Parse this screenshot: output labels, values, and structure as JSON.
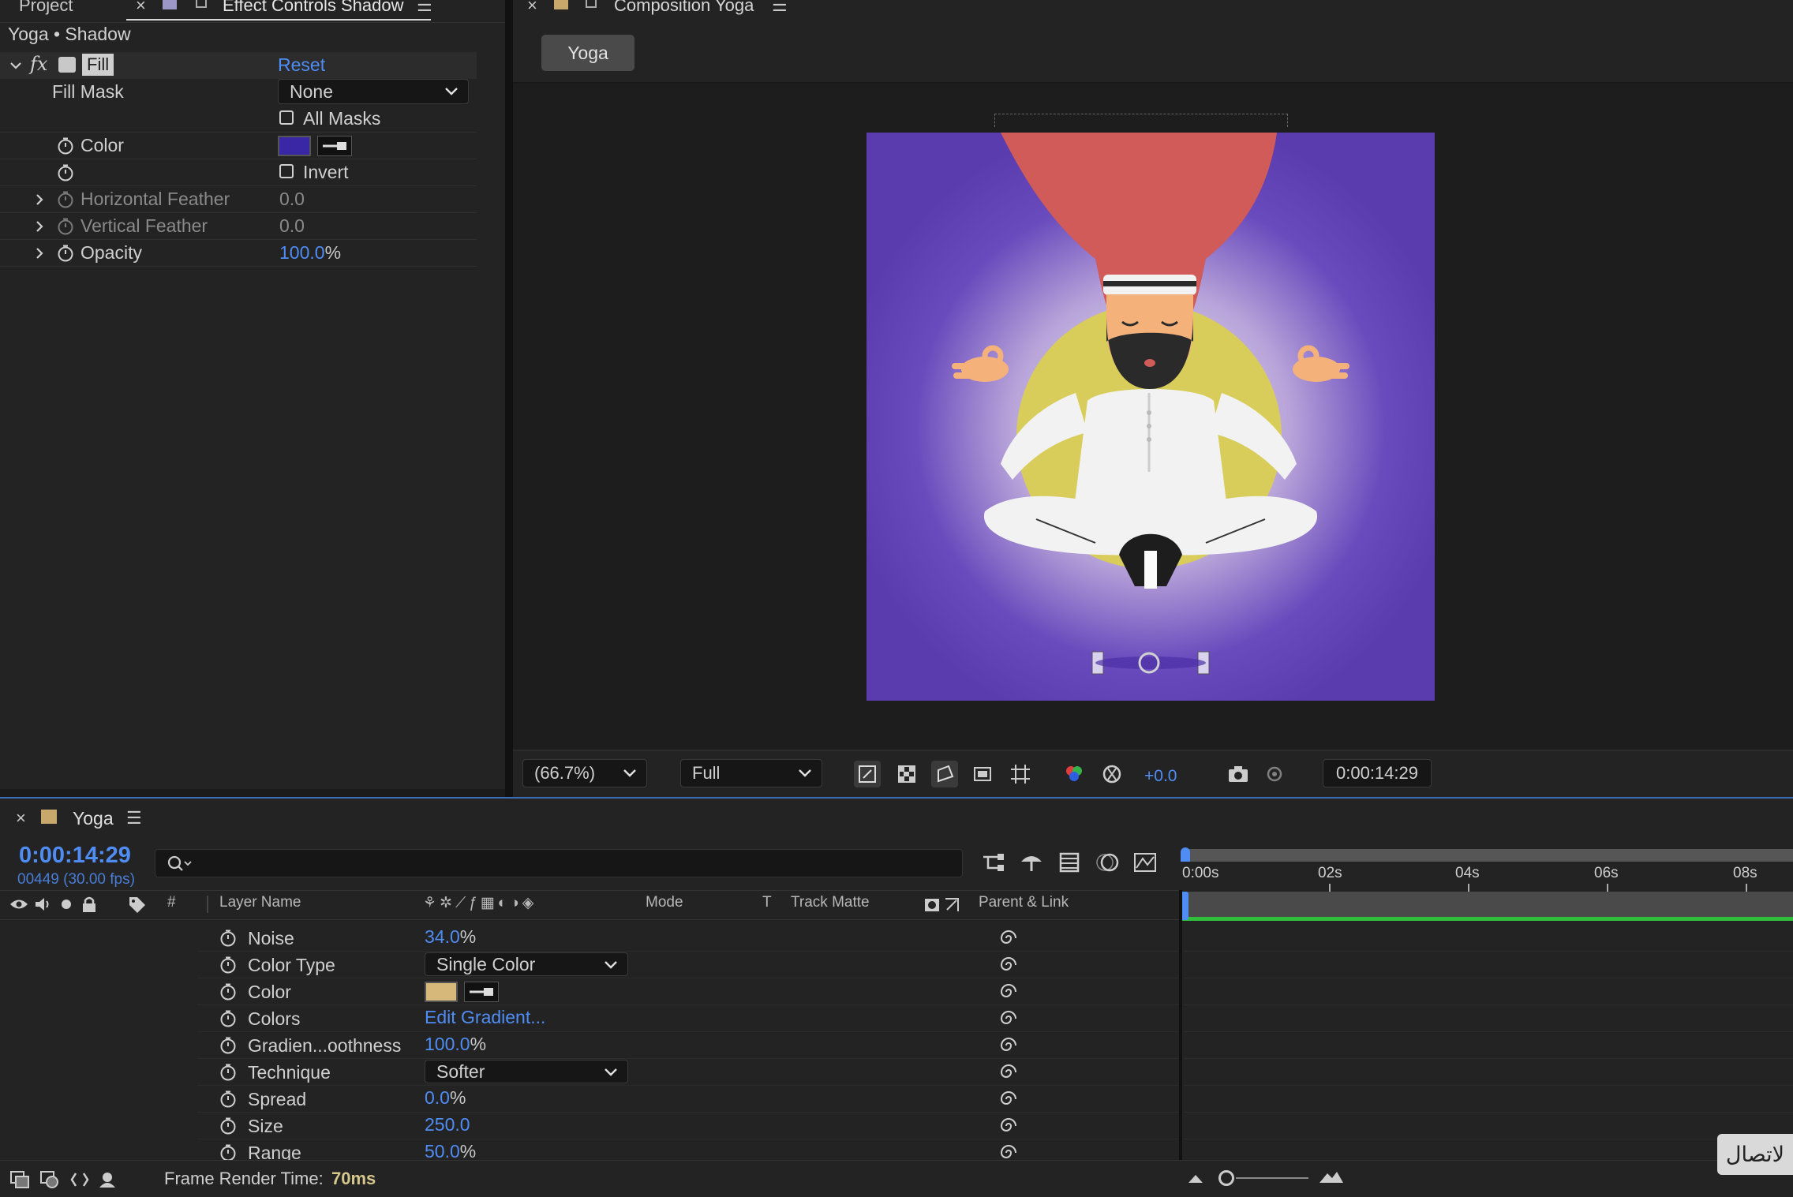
{
  "effect_controls": {
    "tab_project": "Project",
    "tab_title": "Effect Controls Shadow",
    "breadcrumb": "Yoga • Shadow",
    "effect": {
      "fx_label": "fx",
      "name": "Fill",
      "reset_label": "Reset"
    },
    "fill_mask": {
      "label": "Fill Mask",
      "value": "None"
    },
    "all_masks": {
      "label": "All Masks"
    },
    "color": {
      "label": "Color",
      "swatch": "#3a27a6"
    },
    "invert": {
      "label": "Invert"
    },
    "horizontal_feather": {
      "label": "Horizontal Feather",
      "value": "0.0"
    },
    "vertical_feather": {
      "label": "Vertical Feather",
      "value": "0.0"
    },
    "opacity": {
      "label": "Opacity",
      "value": "100.0",
      "unit": "%"
    }
  },
  "composition": {
    "tab_title": "Composition Yoga",
    "tab_button": "Yoga",
    "zoom": "(66.7%)",
    "resolution": "Full",
    "exposure": "+0.0",
    "timecode": "0:00:14:29"
  },
  "timeline": {
    "tab_title": "Yoga",
    "timecode": "0:00:14:29",
    "frame_info": "00449 (30.00 fps)",
    "columns": {
      "number": "#",
      "layer_name": "Layer Name",
      "mode": "Mode",
      "t": "T",
      "track_matte": "Track Matte",
      "parent_link": "Parent & Link"
    },
    "ruler": [
      "0:00s",
      "02s",
      "04s",
      "06s",
      "08s"
    ],
    "properties": [
      {
        "label": "Noise",
        "value": "34.0",
        "unit": "%"
      },
      {
        "label": "Color Type",
        "value": "Single Color"
      },
      {
        "label": "Color",
        "swatch": "#d6b87a"
      },
      {
        "label": "Colors",
        "value": "Edit Gradient..."
      },
      {
        "label": "Gradien...oothness",
        "value": "100.0",
        "unit": "%"
      },
      {
        "label": "Technique",
        "value": "Softer"
      },
      {
        "label": "Spread",
        "value": "0.0",
        "unit": "%"
      },
      {
        "label": "Size",
        "value": "250.0"
      },
      {
        "label": "Range",
        "value": "50.0",
        "unit": "%"
      }
    ],
    "frame_render_label": "Frame Render Time:",
    "frame_render_value": "70ms",
    "connect_button": "لاتصال"
  },
  "colors": {
    "accent_blue": "#4f8df5",
    "canvas_bg": "#5d3fb0",
    "sun": "#d8cd5a",
    "hair": "#d05b58",
    "work_area_green": "#2fbf3a"
  }
}
